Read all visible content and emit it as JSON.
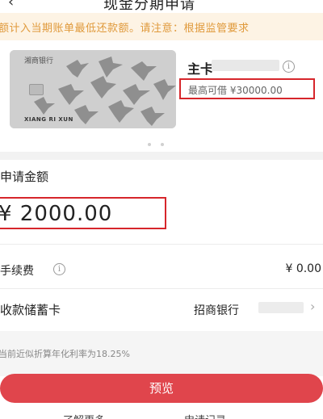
{
  "header": {
    "title": "现金分期申请",
    "back_icon": "back-arrow-icon"
  },
  "notice": {
    "text": "额计入当期账单最低还款额。请注意：根据监管要求"
  },
  "card": {
    "bank_name": "湘商银行",
    "holder": "XIANG RI XUN",
    "type_label": "主卡",
    "limit_text": "最高可借 ¥30000.00"
  },
  "amount": {
    "label": "申请金额",
    "value": "¥ 2000.00"
  },
  "fee": {
    "label": "手续费",
    "value": "¥ 0.00"
  },
  "account": {
    "label": "收款储蓄卡",
    "bank": "招商银行"
  },
  "rate_text": "当前近似折算年化利率为18.25%",
  "preview_button": "预览",
  "bottom_links": {
    "left": "了解更多",
    "right": "申请记录"
  },
  "colors": {
    "accent": "#e0454c",
    "highlight_border": "#d6262b",
    "notice_text": "#e09a3c",
    "notice_bg": "#fdf3e4"
  }
}
